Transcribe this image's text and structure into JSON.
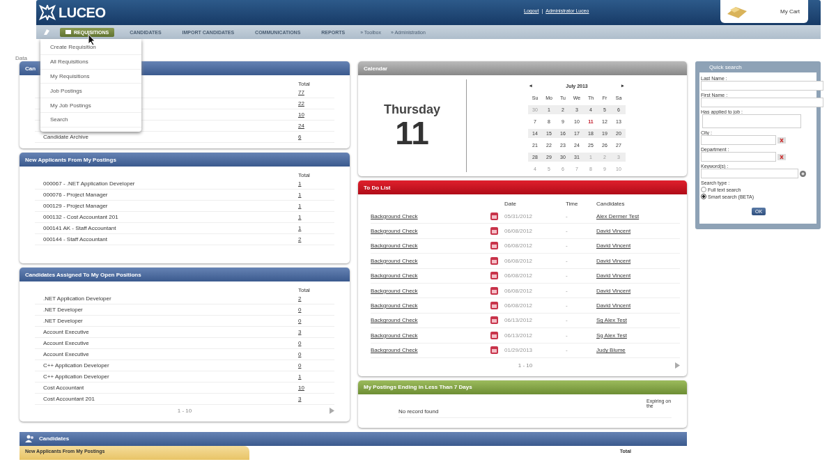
{
  "header": {
    "logo": "LUCEO",
    "links": [
      "Logout",
      "Administrator Luceo"
    ],
    "separator": "|",
    "cart": "My Cart"
  },
  "nav": {
    "items": [
      {
        "label": "REQUISITIONS",
        "selected": true
      },
      {
        "label": "CANDIDATES",
        "selected": false
      },
      {
        "label": "IMPORT CANDIDATES",
        "selected": false
      },
      {
        "label": "COMMUNICATIONS",
        "selected": false
      },
      {
        "label": "REPORTS",
        "selected": false
      }
    ],
    "extra_links": [
      "» Toolbox",
      "» Administration"
    ],
    "dropdown": [
      "Create Requisition",
      "All Requisitions",
      "My Requisitions",
      "Job Postings",
      "My Job Postings",
      "Search"
    ]
  },
  "breadcrumb": "Data",
  "candidates_panel": {
    "title": "Can",
    "total_header": "Total",
    "rows": [
      {
        "label": "",
        "total": "77"
      },
      {
        "label": "",
        "total": "22"
      },
      {
        "label": "",
        "total": "10"
      },
      {
        "label": "",
        "total": "24"
      },
      {
        "label": "Candidate Archive",
        "total": "6"
      }
    ]
  },
  "new_applicants": {
    "title": "New Applicants From My Postings",
    "total_header": "Total",
    "rows": [
      {
        "label": "000067 - .NET Application Developer",
        "total": "1"
      },
      {
        "label": "000076 - Project Manager",
        "total": "1"
      },
      {
        "label": "000129 - Project Manager",
        "total": "1"
      },
      {
        "label": "000132 - Cost Accountant 201",
        "total": "1"
      },
      {
        "label": "000141 AK - Staff Accountant",
        "total": "1"
      },
      {
        "label": "000144 - Staff Accountant",
        "total": "2"
      }
    ]
  },
  "assigned": {
    "title": "Candidates Assigned To My Open Positions",
    "total_header": "Total",
    "pager": "1 - 10",
    "rows": [
      {
        "label": ".NET Application Developer",
        "total": "2"
      },
      {
        "label": ".NET Developer",
        "total": "0"
      },
      {
        "label": ".NET Developer",
        "total": "0"
      },
      {
        "label": "Account Executive",
        "total": "3"
      },
      {
        "label": "Account Executive",
        "total": "0"
      },
      {
        "label": "Account Executive",
        "total": "0"
      },
      {
        "label": "C++ Application Developer",
        "total": "0"
      },
      {
        "label": "C++ Application Developer",
        "total": "1"
      },
      {
        "label": "Cost Accountant",
        "total": "10"
      },
      {
        "label": "Cost Accountant 201",
        "total": "3"
      }
    ]
  },
  "calendar": {
    "title": "Calendar",
    "weekday": "Thursday",
    "day": "11",
    "month": "July 2013",
    "prev": "◂",
    "next": "▸",
    "weekdays": [
      "Su",
      "Mo",
      "Tu",
      "We",
      "Th",
      "Fr",
      "Sa"
    ],
    "weeks": [
      [
        {
          "text": "30",
          "outside": true,
          "today": false
        },
        {
          "text": "1",
          "outside": false,
          "today": false
        },
        {
          "text": "2",
          "outside": false,
          "today": false
        },
        {
          "text": "3",
          "outside": false,
          "today": false
        },
        {
          "text": "4",
          "outside": false,
          "today": false
        },
        {
          "text": "5",
          "outside": false,
          "today": false
        },
        {
          "text": "6",
          "outside": false,
          "today": false
        }
      ],
      [
        {
          "text": "7",
          "outside": false,
          "today": false
        },
        {
          "text": "8",
          "outside": false,
          "today": false
        },
        {
          "text": "9",
          "outside": false,
          "today": false
        },
        {
          "text": "10",
          "outside": false,
          "today": false
        },
        {
          "text": "11",
          "outside": false,
          "today": true
        },
        {
          "text": "12",
          "outside": false,
          "today": false
        },
        {
          "text": "13",
          "outside": false,
          "today": false
        }
      ],
      [
        {
          "text": "14",
          "outside": false,
          "today": false
        },
        {
          "text": "15",
          "outside": false,
          "today": false
        },
        {
          "text": "16",
          "outside": false,
          "today": false
        },
        {
          "text": "17",
          "outside": false,
          "today": false
        },
        {
          "text": "18",
          "outside": false,
          "today": false
        },
        {
          "text": "19",
          "outside": false,
          "today": false
        },
        {
          "text": "20",
          "outside": false,
          "today": false
        }
      ],
      [
        {
          "text": "21",
          "outside": false,
          "today": false
        },
        {
          "text": "22",
          "outside": false,
          "today": false
        },
        {
          "text": "23",
          "outside": false,
          "today": false
        },
        {
          "text": "24",
          "outside": false,
          "today": false
        },
        {
          "text": "25",
          "outside": false,
          "today": false
        },
        {
          "text": "26",
          "outside": false,
          "today": false
        },
        {
          "text": "27",
          "outside": false,
          "today": false
        }
      ],
      [
        {
          "text": "28",
          "outside": false,
          "today": false
        },
        {
          "text": "29",
          "outside": false,
          "today": false
        },
        {
          "text": "30",
          "outside": false,
          "today": false
        },
        {
          "text": "31",
          "outside": false,
          "today": false
        },
        {
          "text": "1",
          "outside": true,
          "today": false
        },
        {
          "text": "2",
          "outside": true,
          "today": false
        },
        {
          "text": "3",
          "outside": true,
          "today": false
        }
      ],
      [
        {
          "text": "4",
          "outside": true,
          "today": false
        },
        {
          "text": "5",
          "outside": true,
          "today": false
        },
        {
          "text": "6",
          "outside": true,
          "today": false
        },
        {
          "text": "7",
          "outside": true,
          "today": false
        },
        {
          "text": "8",
          "outside": true,
          "today": false
        },
        {
          "text": "9",
          "outside": true,
          "today": false
        },
        {
          "text": "10",
          "outside": true,
          "today": false
        }
      ]
    ]
  },
  "todo": {
    "title": "To Do List",
    "columns": [
      "Date",
      "Time",
      "Candidates"
    ],
    "pager": "1 - 10",
    "rows": [
      {
        "task": "Background Check",
        "date": "05/31/2012",
        "time": "-",
        "candidate": "Alex Dermer Test"
      },
      {
        "task": "Background Check",
        "date": "06/08/2012",
        "time": "-",
        "candidate": "David Vincent"
      },
      {
        "task": "Background Check",
        "date": "06/08/2012",
        "time": "-",
        "candidate": "David Vincent"
      },
      {
        "task": "Background Check",
        "date": "06/08/2012",
        "time": "-",
        "candidate": "David Vincent"
      },
      {
        "task": "Background Check",
        "date": "06/08/2012",
        "time": "-",
        "candidate": "David Vincent"
      },
      {
        "task": "Background Check",
        "date": "06/08/2012",
        "time": "-",
        "candidate": "David Vincent"
      },
      {
        "task": "Background Check",
        "date": "06/08/2012",
        "time": "-",
        "candidate": "David Vincent"
      },
      {
        "task": "Background Check",
        "date": "06/13/2012",
        "time": "-",
        "candidate": "Sg Alex Test"
      },
      {
        "task": "Background Check",
        "date": "06/13/2012",
        "time": "-",
        "candidate": "Sg Alex Test"
      },
      {
        "task": "Background Check",
        "date": "01/29/2013",
        "time": "-",
        "candidate": "Judy Blume"
      }
    ]
  },
  "postings": {
    "title": "My Postings Ending in Less Than 7 Days",
    "column": "Expiring on the",
    "empty": "No record found"
  },
  "quick_search": {
    "title": "Quick search",
    "fields": [
      {
        "label": "Last Name :",
        "kind": "wide"
      },
      {
        "label": "First Name :",
        "kind": "wide"
      },
      {
        "label": "Has applied to job :",
        "kind": "box"
      },
      {
        "label": "City :",
        "kind": "clearable"
      },
      {
        "label": "Department :",
        "kind": "clearable"
      },
      {
        "label": "Keyword(s) :",
        "kind": "help"
      }
    ],
    "search_type_label": "Search type :",
    "search_types": [
      {
        "label": "Full text search",
        "selected": false
      },
      {
        "label": "Smart search (BETA)",
        "selected": true
      }
    ],
    "ok": "OK"
  },
  "bottom": {
    "title": "Candidates",
    "tab": "New Applicants From My Postings",
    "total_header": "Total"
  }
}
